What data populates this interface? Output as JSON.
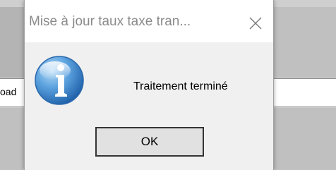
{
  "background": {
    "partial_text": "oad"
  },
  "dialog": {
    "title": "Mise à jour taux taxe tran...",
    "close_icon": "close-icon",
    "message_icon": "info-icon",
    "message": "Traitement terminé",
    "ok_label": "OK"
  },
  "colors": {
    "dialog_bg": "#f0f0f0",
    "titlebar_bg": "#ffffff",
    "title_text": "#8a8a8a",
    "button_border": "#333333"
  }
}
